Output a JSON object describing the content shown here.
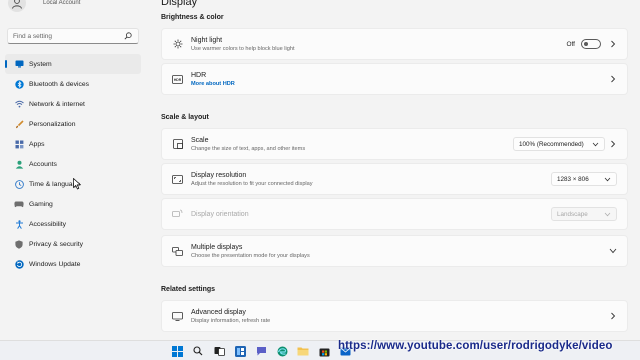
{
  "window": {
    "page_title": "Display"
  },
  "profile": {
    "account_type": "Local Account"
  },
  "search": {
    "placeholder": "Find a setting"
  },
  "sidebar": {
    "items": [
      {
        "label": "System",
        "icon": "monitor-icon",
        "active": true,
        "color": "#0067c0"
      },
      {
        "label": "Bluetooth & devices",
        "icon": "bluetooth-icon",
        "color": "#0078d4"
      },
      {
        "label": "Network & internet",
        "icon": "wifi-icon",
        "color": "#4a6aa8"
      },
      {
        "label": "Personalization",
        "icon": "brush-icon",
        "color": "#d08b2c"
      },
      {
        "label": "Apps",
        "icon": "apps-icon",
        "color": "#4a6aa8"
      },
      {
        "label": "Accounts",
        "icon": "person-icon",
        "color": "#2aa07a"
      },
      {
        "label": "Time & language",
        "icon": "globe-clock-icon",
        "color": "#2e78c9"
      },
      {
        "label": "Gaming",
        "icon": "gamepad-icon",
        "color": "#6e6e6e"
      },
      {
        "label": "Accessibility",
        "icon": "accessibility-icon",
        "color": "#1f7ad6"
      },
      {
        "label": "Privacy & security",
        "icon": "shield-icon",
        "color": "#6e6e6e"
      },
      {
        "label": "Windows Update",
        "icon": "update-icon",
        "color": "#0067c0"
      }
    ]
  },
  "sections": {
    "brightness": "Brightness & color",
    "scale_layout": "Scale & layout",
    "related": "Related settings"
  },
  "night_light": {
    "title": "Night light",
    "subtitle": "Use warmer colors to help block blue light",
    "state": "Off"
  },
  "hdr": {
    "title": "HDR",
    "link": "More about HDR"
  },
  "scale": {
    "title": "Scale",
    "subtitle": "Change the size of text, apps, and other items",
    "value": "100% (Recommended)"
  },
  "resolution": {
    "title": "Display resolution",
    "subtitle": "Adjust the resolution to fit your connected display",
    "value": "1283 × 806"
  },
  "orientation": {
    "title": "Display orientation",
    "value": "Landscape"
  },
  "multiple": {
    "title": "Multiple displays",
    "subtitle": "Choose the presentation mode for your displays"
  },
  "advanced": {
    "title": "Advanced display",
    "subtitle": "Display information, refresh rate"
  },
  "taskbar": {
    "icons": [
      "windows-start-icon",
      "search-icon",
      "task-view-icon",
      "widgets-icon",
      "chat-icon",
      "edge-icon",
      "file-explorer-icon",
      "store-icon",
      "mail-icon"
    ]
  },
  "overlay": {
    "watermark": "https://www.youtube.com/user/rodrigodyke/video"
  }
}
